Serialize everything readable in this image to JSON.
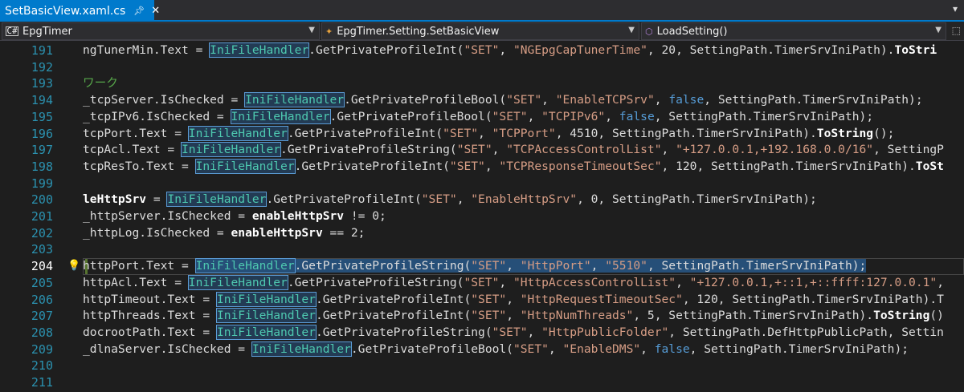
{
  "tabs": [
    {
      "label": "SetBasicView.xaml.cs",
      "active": true,
      "pin_icon": "pin-icon",
      "close_icon": "close-icon"
    }
  ],
  "navbar": {
    "project": "EpgTimer",
    "type": "EpgTimer.Setting.SetBasicView",
    "member": "LoadSetting()"
  },
  "colors": {
    "accent": "#007acc",
    "background": "#1e1e1e",
    "line_number": "#2b91af",
    "type": "#4ec9b0",
    "string": "#d69d85",
    "keyword": "#569cd6",
    "selection": "#264f78"
  },
  "editor": {
    "current_line": 204,
    "lines": [
      {
        "num": "191",
        "segs": [
          {
            "t": "ngTunerMin.Text = "
          },
          {
            "t": "IniFileHandler",
            "c": "tok-type"
          },
          {
            "t": ".GetPrivateProfileInt("
          },
          {
            "t": "\"SET\"",
            "c": "tok-str"
          },
          {
            "t": ", "
          },
          {
            "t": "\"NGEpgCapTunerTime\"",
            "c": "tok-str"
          },
          {
            "t": ", 20, SettingPath.TimerSrvIniPath)."
          },
          {
            "t": "ToStri",
            "c": "tok-bold"
          }
        ]
      },
      {
        "num": "192",
        "segs": []
      },
      {
        "num": "193",
        "segs": [
          {
            "t": "ワーク",
            "c": "tok-cmt"
          }
        ]
      },
      {
        "num": "194",
        "segs": [
          {
            "t": "_tcpServer.IsChecked = "
          },
          {
            "t": "IniFileHandler",
            "c": "tok-type"
          },
          {
            "t": ".GetPrivateProfileBool("
          },
          {
            "t": "\"SET\"",
            "c": "tok-str"
          },
          {
            "t": ", "
          },
          {
            "t": "\"EnableTCPSrv\"",
            "c": "tok-str"
          },
          {
            "t": ", "
          },
          {
            "t": "false",
            "c": "tok-kw"
          },
          {
            "t": ", SettingPath.TimerSrvIniPath);"
          }
        ]
      },
      {
        "num": "195",
        "segs": [
          {
            "t": "_tcpIPv6.IsChecked = "
          },
          {
            "t": "IniFileHandler",
            "c": "tok-type"
          },
          {
            "t": ".GetPrivateProfileBool("
          },
          {
            "t": "\"SET\"",
            "c": "tok-str"
          },
          {
            "t": ", "
          },
          {
            "t": "\"TCPIPv6\"",
            "c": "tok-str"
          },
          {
            "t": ", "
          },
          {
            "t": "false",
            "c": "tok-kw"
          },
          {
            "t": ", SettingPath.TimerSrvIniPath);"
          }
        ]
      },
      {
        "num": "196",
        "segs": [
          {
            "t": "tcpPort.Text = "
          },
          {
            "t": "IniFileHandler",
            "c": "tok-type"
          },
          {
            "t": ".GetPrivateProfileInt("
          },
          {
            "t": "\"SET\"",
            "c": "tok-str"
          },
          {
            "t": ", "
          },
          {
            "t": "\"TCPPort\"",
            "c": "tok-str"
          },
          {
            "t": ", 4510, SettingPath.TimerSrvIniPath)."
          },
          {
            "t": "ToString",
            "c": "tok-bold"
          },
          {
            "t": "();"
          }
        ]
      },
      {
        "num": "197",
        "segs": [
          {
            "t": "tcpAcl.Text = "
          },
          {
            "t": "IniFileHandler",
            "c": "tok-type"
          },
          {
            "t": ".GetPrivateProfileString("
          },
          {
            "t": "\"SET\"",
            "c": "tok-str"
          },
          {
            "t": ", "
          },
          {
            "t": "\"TCPAccessControlList\"",
            "c": "tok-str"
          },
          {
            "t": ", "
          },
          {
            "t": "\"+127.0.0.1,+192.168.0.0/16\"",
            "c": "tok-str"
          },
          {
            "t": ", SettingP"
          }
        ]
      },
      {
        "num": "198",
        "segs": [
          {
            "t": "tcpResTo.Text = "
          },
          {
            "t": "IniFileHandler",
            "c": "tok-type"
          },
          {
            "t": ".GetPrivateProfileInt("
          },
          {
            "t": "\"SET\"",
            "c": "tok-str"
          },
          {
            "t": ", "
          },
          {
            "t": "\"TCPResponseTimeoutSec\"",
            "c": "tok-str"
          },
          {
            "t": ", 120, SettingPath.TimerSrvIniPath)."
          },
          {
            "t": "ToSt",
            "c": "tok-bold"
          }
        ]
      },
      {
        "num": "199",
        "segs": []
      },
      {
        "num": "200",
        "segs": [
          {
            "t": "leHttpSrv",
            "c": "tok-bold"
          },
          {
            "t": " = "
          },
          {
            "t": "IniFileHandler",
            "c": "tok-type"
          },
          {
            "t": ".GetPrivateProfileInt("
          },
          {
            "t": "\"SET\"",
            "c": "tok-str"
          },
          {
            "t": ", "
          },
          {
            "t": "\"EnableHttpSrv\"",
            "c": "tok-str"
          },
          {
            "t": ", 0, SettingPath.TimerSrvIniPath);"
          }
        ]
      },
      {
        "num": "201",
        "segs": [
          {
            "t": "_httpServer.IsChecked = "
          },
          {
            "t": "enableHttpSrv",
            "c": "tok-bold"
          },
          {
            "t": " != 0;"
          }
        ]
      },
      {
        "num": "202",
        "segs": [
          {
            "t": "_httpLog.IsChecked = "
          },
          {
            "t": "enableHttpSrv",
            "c": "tok-bold"
          },
          {
            "t": " == 2;"
          }
        ]
      },
      {
        "num": "203",
        "segs": []
      },
      {
        "num": "204",
        "segs": [
          {
            "t": "httpPort.Text = "
          },
          {
            "t": "IniFileHandler",
            "c": "tok-type sel"
          },
          {
            "t": ".GetPrivateProfileString(",
            "c": "sel"
          },
          {
            "t": "\"SET\"",
            "c": "tok-str sel"
          },
          {
            "t": ", ",
            "c": "sel"
          },
          {
            "t": "\"HttpPort\"",
            "c": "tok-str sel"
          },
          {
            "t": ", ",
            "c": "sel"
          },
          {
            "t": "\"5510\"",
            "c": "tok-str sel"
          },
          {
            "t": ", SettingPath.TimerSrvIniPath);",
            "c": "sel"
          }
        ]
      },
      {
        "num": "205",
        "segs": [
          {
            "t": "httpAcl.Text = "
          },
          {
            "t": "IniFileHandler",
            "c": "tok-type"
          },
          {
            "t": ".GetPrivateProfileString("
          },
          {
            "t": "\"SET\"",
            "c": "tok-str"
          },
          {
            "t": ", "
          },
          {
            "t": "\"HttpAccessControlList\"",
            "c": "tok-str"
          },
          {
            "t": ", "
          },
          {
            "t": "\"+127.0.0.1,+::1,+::ffff:127.0.0.1\"",
            "c": "tok-str"
          },
          {
            "t": ","
          }
        ]
      },
      {
        "num": "206",
        "segs": [
          {
            "t": "httpTimeout.Text = "
          },
          {
            "t": "IniFileHandler",
            "c": "tok-type"
          },
          {
            "t": ".GetPrivateProfileInt("
          },
          {
            "t": "\"SET\"",
            "c": "tok-str"
          },
          {
            "t": ", "
          },
          {
            "t": "\"HttpRequestTimeoutSec\"",
            "c": "tok-str"
          },
          {
            "t": ", 120, SettingPath.TimerSrvIniPath).T"
          }
        ]
      },
      {
        "num": "207",
        "segs": [
          {
            "t": "httpThreads.Text = "
          },
          {
            "t": "IniFileHandler",
            "c": "tok-type"
          },
          {
            "t": ".GetPrivateProfileInt("
          },
          {
            "t": "\"SET\"",
            "c": "tok-str"
          },
          {
            "t": ", "
          },
          {
            "t": "\"HttpNumThreads\"",
            "c": "tok-str"
          },
          {
            "t": ", 5, SettingPath.TimerSrvIniPath)."
          },
          {
            "t": "ToString",
            "c": "tok-bold"
          },
          {
            "t": "()"
          }
        ]
      },
      {
        "num": "208",
        "segs": [
          {
            "t": "docrootPath.Text = "
          },
          {
            "t": "IniFileHandler",
            "c": "tok-type"
          },
          {
            "t": ".GetPrivateProfileString("
          },
          {
            "t": "\"SET\"",
            "c": "tok-str"
          },
          {
            "t": ", "
          },
          {
            "t": "\"HttpPublicFolder\"",
            "c": "tok-str"
          },
          {
            "t": ", SettingPath.DefHttpPublicPath, Settin"
          }
        ]
      },
      {
        "num": "209",
        "segs": [
          {
            "t": "_dlnaServer.IsChecked = "
          },
          {
            "t": "IniFileHandler",
            "c": "tok-type"
          },
          {
            "t": ".GetPrivateProfileBool("
          },
          {
            "t": "\"SET\"",
            "c": "tok-str"
          },
          {
            "t": ", "
          },
          {
            "t": "\"EnableDMS\"",
            "c": "tok-str"
          },
          {
            "t": ", "
          },
          {
            "t": "false",
            "c": "tok-kw"
          },
          {
            "t": ", SettingPath.TimerSrvIniPath);"
          }
        ]
      },
      {
        "num": "210",
        "segs": []
      },
      {
        "num": "211",
        "segs": []
      }
    ]
  }
}
